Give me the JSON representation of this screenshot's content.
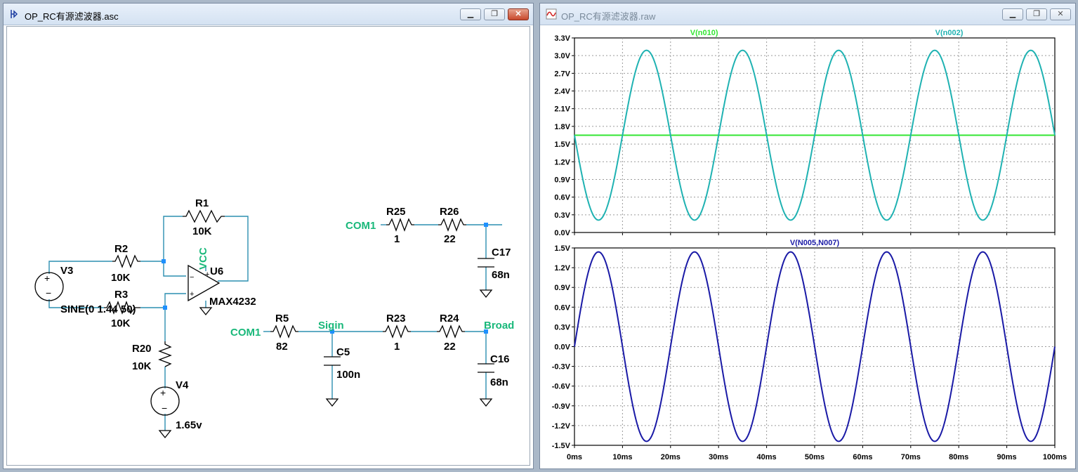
{
  "windows": {
    "schematic": {
      "title": "OP_RC有源滤波器.asc",
      "icon": "schematic-icon"
    },
    "waveform": {
      "title": "OP_RC有源滤波器.raw",
      "icon": "waveform-icon"
    }
  },
  "schematic": {
    "components": [
      {
        "id": "R1",
        "value": "10K"
      },
      {
        "id": "R2",
        "value": "10K"
      },
      {
        "id": "R3",
        "value": "10K"
      },
      {
        "id": "R20",
        "value": "10K"
      },
      {
        "id": "V3",
        "value": "SINE(0 1.44 50)"
      },
      {
        "id": "V4",
        "value": "1.65v"
      },
      {
        "id": "U6",
        "value": "MAX4232"
      },
      {
        "id": "R25",
        "value": "1"
      },
      {
        "id": "R26",
        "value": "22"
      },
      {
        "id": "C17",
        "value": "68n"
      },
      {
        "id": "R5",
        "value": "82"
      },
      {
        "id": "C5",
        "value": "100n"
      },
      {
        "id": "R23",
        "value": "1"
      },
      {
        "id": "R24",
        "value": "22"
      },
      {
        "id": "C16",
        "value": "68n"
      }
    ],
    "nets": {
      "vcc": "VCC",
      "com1_top": "COM1",
      "com1_bottom": "COM1",
      "sigin": "Sigin",
      "broad": "Broad"
    },
    "colors": {
      "wire": "#2c8fb0",
      "net": "#19b87a",
      "node": "#1e90ff",
      "component": "#000000"
    }
  },
  "chart_data": [
    {
      "type": "line",
      "panel": "top",
      "x_unit": "ms",
      "xlim": [
        0,
        100
      ],
      "ylim": [
        0,
        3.3
      ],
      "x_ticks": [
        "0ms",
        "10ms",
        "20ms",
        "30ms",
        "40ms",
        "50ms",
        "60ms",
        "70ms",
        "80ms",
        "90ms",
        "100ms"
      ],
      "y_ticks": [
        "0.0V",
        "0.3V",
        "0.6V",
        "0.9V",
        "1.2V",
        "1.5V",
        "1.8V",
        "2.1V",
        "2.4V",
        "2.7V",
        "3.0V",
        "3.3V"
      ],
      "grid": true,
      "series": [
        {
          "name": "V(n010)",
          "color": "#33e633",
          "kind": "constant",
          "value": 1.65
        },
        {
          "name": "V(n002)",
          "color": "#1fb2b2",
          "kind": "sine",
          "offset": 1.65,
          "amplitude": 1.44,
          "freq_hz": 50,
          "phase": "inverted"
        }
      ]
    },
    {
      "type": "line",
      "panel": "bottom",
      "x_unit": "ms",
      "xlim": [
        0,
        100
      ],
      "ylim": [
        -1.5,
        1.5
      ],
      "x_ticks": [
        "0ms",
        "10ms",
        "20ms",
        "30ms",
        "40ms",
        "50ms",
        "60ms",
        "70ms",
        "80ms",
        "90ms",
        "100ms"
      ],
      "y_ticks": [
        "1.5V",
        "1.2V",
        "0.9V",
        "0.6V",
        "0.3V",
        "0.0V",
        "-0.3V",
        "-0.6V",
        "-0.9V",
        "-1.2V",
        "-1.5V"
      ],
      "grid": true,
      "series": [
        {
          "name": "V(N005,N007)",
          "color": "#1a1aa6",
          "kind": "sine",
          "offset": 0,
          "amplitude": 1.44,
          "freq_hz": 50,
          "phase": "normal"
        }
      ]
    }
  ]
}
